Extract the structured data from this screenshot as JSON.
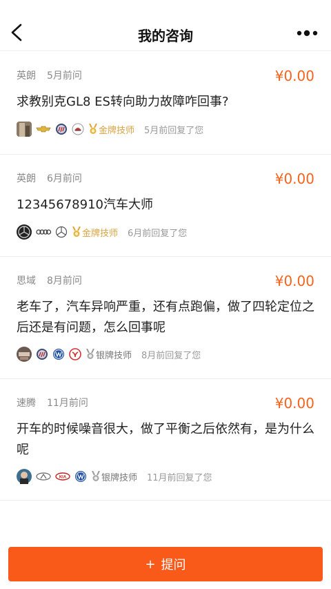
{
  "header": {
    "title": "我的咨询"
  },
  "cards": [
    {
      "car": "英朗",
      "time": "5月前问",
      "price": "¥0.00",
      "question": "求教别克GL8 ES转向助力故障咋回事?",
      "rank": "金牌技师",
      "reply": "5月前回复了您"
    },
    {
      "car": "英朗",
      "time": "6月前问",
      "price": "¥0.00",
      "question": "12345678910汽车大师",
      "rank": "金牌技师",
      "reply": "6月前回复了您"
    },
    {
      "car": "思域",
      "time": "8月前问",
      "price": "¥0.00",
      "question": "老车了，汽车异响严重，还有点跑偏，做了四轮定位之后还是有问题，怎么回事呢",
      "rank": "银牌技师",
      "reply": "8月前回复了您"
    },
    {
      "car": "速腾",
      "time": "11月前问",
      "price": "¥0.00",
      "question": "开车的时候噪音很大，做了平衡之后依然有，是为什么呢",
      "rank": "银牌技师",
      "reply": "11月前回复了您"
    }
  ],
  "ask_button": {
    "label": "提问"
  },
  "colors": {
    "accent": "#f5631b",
    "button": "#f95a19",
    "gold": "#d9a441"
  }
}
